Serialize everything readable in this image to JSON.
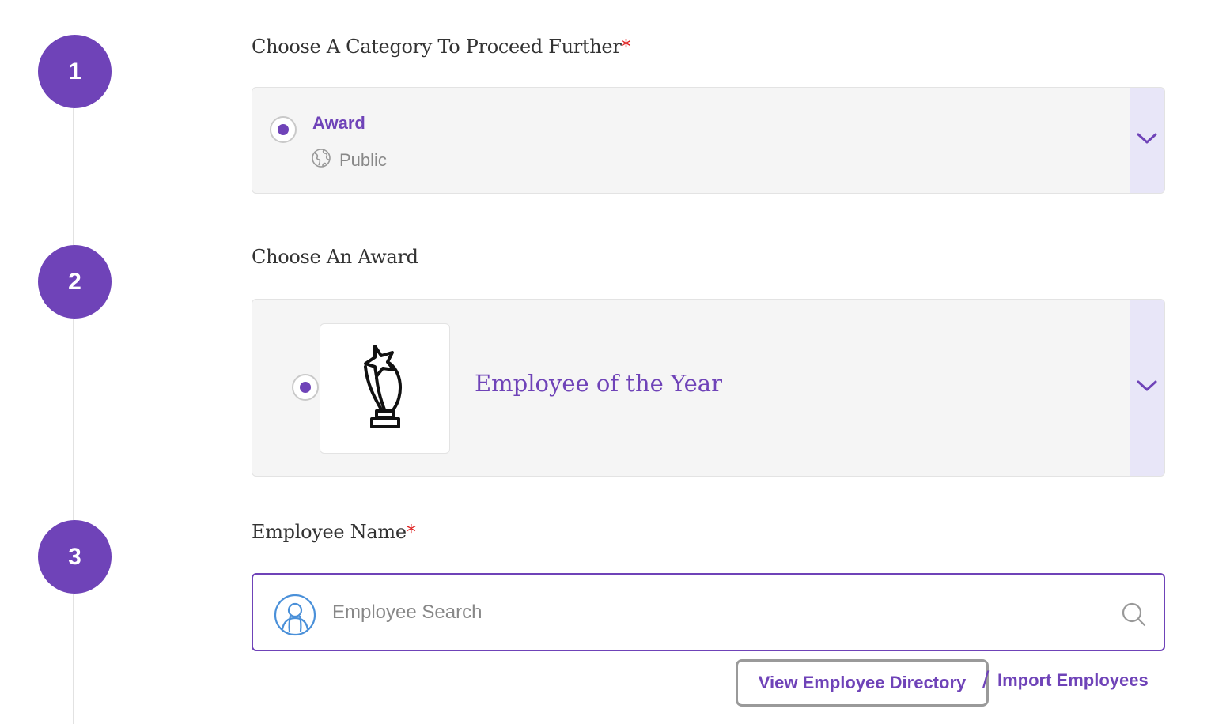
{
  "steps": [
    "1",
    "2",
    "3"
  ],
  "category_section": {
    "title": "Choose A Category To Proceed Further",
    "required_mark": "*",
    "selected": {
      "name": "Award",
      "visibility": "Public",
      "visibility_icon": "globe-icon"
    },
    "expand_icon": "chevron-down-icon"
  },
  "award_section": {
    "title": "Choose An Award",
    "selected": {
      "name": "Employee of the Year",
      "icon": "trophy-star-icon"
    },
    "expand_icon": "chevron-down-icon"
  },
  "employee_section": {
    "title": "Employee Name",
    "required_mark": "*",
    "search": {
      "placeholder": "Employee Search",
      "value": "",
      "leading_icon": "user-avatar-icon",
      "trailing_icon": "search-icon"
    },
    "links": {
      "directory": "View Employee Directory",
      "separator": "/",
      "import": "Import Employees"
    }
  },
  "colors": {
    "accent": "#6f43b8",
    "required": "#e02424",
    "card_bg": "#f5f5f5",
    "chevron_zone_bg": "#e8e6f8"
  }
}
